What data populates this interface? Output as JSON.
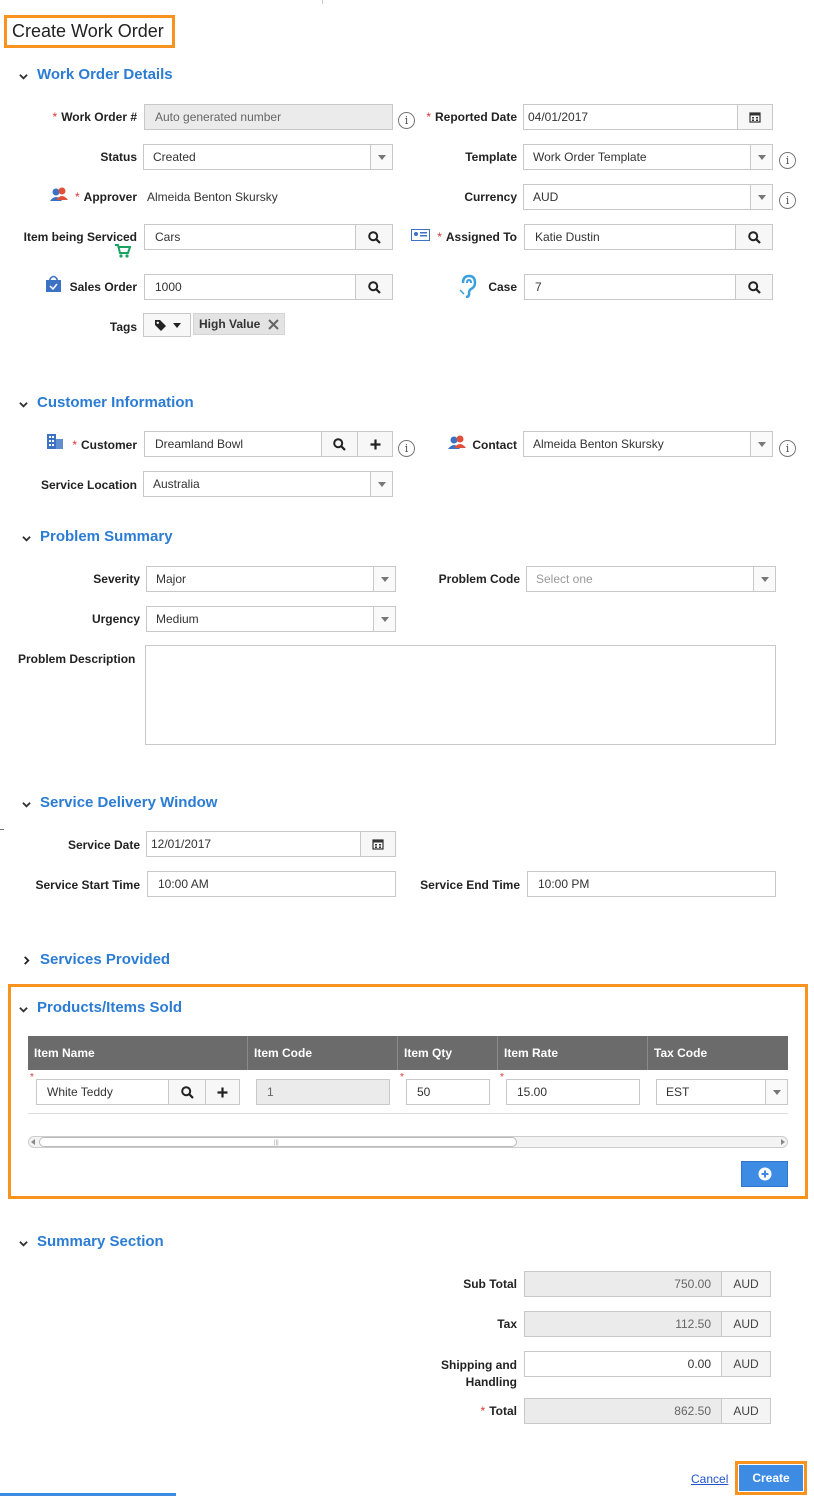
{
  "page_title": "Create Work Order",
  "sections": {
    "work_order_details": "Work Order Details",
    "customer_information": "Customer Information",
    "problem_summary": "Problem Summary",
    "service_delivery_window": "Service Delivery Window",
    "services_provided": "Services Provided",
    "products_items_sold": "Products/Items Sold",
    "summary_section": "Summary Section"
  },
  "work_order": {
    "work_order_num_label": "Work Order #",
    "work_order_num_value": "Auto generated number",
    "reported_date_label": "Reported Date",
    "reported_date_value": "04/01/2017",
    "status_label": "Status",
    "status_value": "Created",
    "template_label": "Template",
    "template_value": "Work Order Template",
    "approver_label": "Approver",
    "approver_value": "Almeida Benton Skursky",
    "currency_label": "Currency",
    "currency_value": "AUD",
    "item_serviced_label": "Item being Serviced",
    "item_serviced_value": "Cars",
    "assigned_to_label": "Assigned To",
    "assigned_to_value": "Katie Dustin",
    "sales_order_label": "Sales Order",
    "sales_order_value": "1000",
    "case_label": "Case",
    "case_value": "7",
    "tags_label": "Tags",
    "tag_value": "High Value"
  },
  "customer": {
    "customer_label": "Customer",
    "customer_value": "Dreamland Bowl",
    "contact_label": "Contact",
    "contact_value": "Almeida Benton Skursky",
    "service_location_label": "Service Location",
    "service_location_value": "Australia"
  },
  "problem": {
    "severity_label": "Severity",
    "severity_value": "Major",
    "problem_code_label": "Problem Code",
    "problem_code_placeholder": "Select one",
    "urgency_label": "Urgency",
    "urgency_value": "Medium",
    "description_label": "Problem Description",
    "description_value": ""
  },
  "delivery": {
    "service_date_label": "Service Date",
    "service_date_value": "12/01/2017",
    "start_time_label": "Service Start Time",
    "start_time_value": "10:00 AM",
    "end_time_label": "Service End Time",
    "end_time_value": "10:00 PM"
  },
  "products": {
    "columns": [
      "Item Name",
      "Item Code",
      "Item Qty",
      "Item Rate",
      "Tax Code"
    ],
    "row": {
      "item_name": "White Teddy",
      "item_code": "1",
      "item_qty": "50",
      "item_rate": "15.00",
      "tax_code": "EST"
    }
  },
  "summary": {
    "sub_total_label": "Sub Total",
    "sub_total_value": "750.00",
    "tax_label": "Tax",
    "tax_value": "112.50",
    "shipping_label_1": "Shipping and",
    "shipping_label_2": "Handling",
    "shipping_value": "0.00",
    "total_label": "Total",
    "total_value": "862.50",
    "currency": "AUD"
  },
  "footer": {
    "cancel_label": "Cancel",
    "create_label": "Create"
  },
  "colors": {
    "section_blue": "#2b7cd3",
    "highlight_orange": "#f7931e",
    "table_header": "#6b6b6b",
    "create_button": "#3d8be3"
  }
}
